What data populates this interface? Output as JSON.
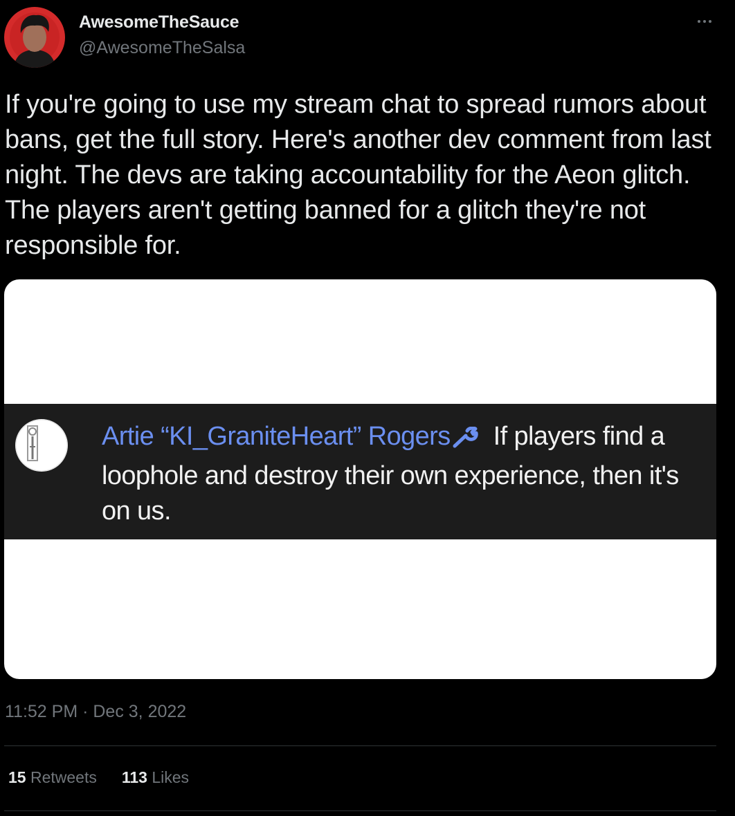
{
  "author": {
    "display_name": "AwesomeTheSauce",
    "handle": "@AwesomeTheSalsa",
    "avatar_icon": "profile-avatar-icon",
    "avatar_bg": "#d42b2b"
  },
  "tweet": {
    "text": "If you're going to use my stream chat to spread rumors about bans, get the full story. Here's another dev comment from last night. The devs are taking accountability for the Aeon glitch. The players aren't getting banned for a glitch they're not responsible for.",
    "timestamp": "11:52 PM · Dec 3, 2022"
  },
  "media": {
    "comment_author": "Artie “KI_GraniteHeart” Rogers",
    "comment_author_badge_icon": "wrench-icon",
    "comment_text": "If players find a loophole and destroy their own experience, then it's on us.",
    "comment_author_color": "#6b8ff0"
  },
  "stats": {
    "retweets_count": "15",
    "retweets_label": "Retweets",
    "likes_count": "113",
    "likes_label": "Likes"
  },
  "colors": {
    "background": "#000000",
    "primary_text": "#e7e9ea",
    "secondary_text": "#71767b",
    "divider": "#2f3336"
  }
}
